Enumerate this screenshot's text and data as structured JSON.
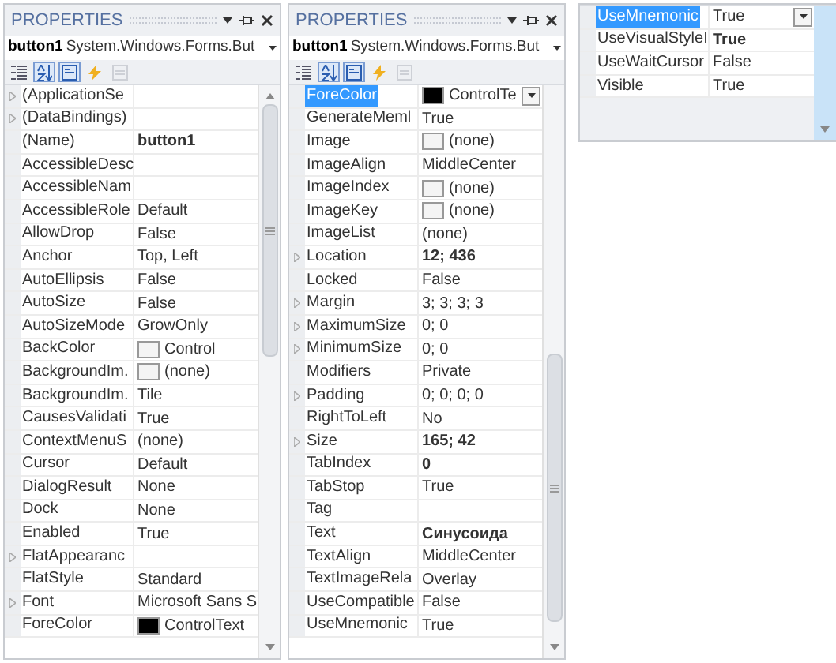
{
  "panels": [
    {
      "title": "PROPERTIES",
      "object_name": "button1",
      "object_type": "System.Windows.Forms.But",
      "toolbar": [
        {
          "kind": "categorized",
          "selected": false,
          "disabled": false
        },
        {
          "kind": "alphabetical",
          "selected": true,
          "disabled": false
        },
        {
          "kind": "properties",
          "selected": true,
          "disabled": false
        },
        {
          "kind": "events",
          "selected": false,
          "disabled": false
        },
        {
          "kind": "pages",
          "selected": false,
          "disabled": true
        }
      ],
      "rows": [
        {
          "name": "(ApplicationSe",
          "value": "",
          "expandable": true,
          "selected": false
        },
        {
          "name": "(DataBindings)",
          "value": "",
          "expandable": true,
          "selected": false
        },
        {
          "name": "(Name)",
          "value": "button1",
          "expandable": false,
          "bold": true,
          "selected": false
        },
        {
          "name": "AccessibleDesc",
          "value": "",
          "expandable": false,
          "selected": false
        },
        {
          "name": "AccessibleNam",
          "value": "",
          "expandable": false,
          "selected": false
        },
        {
          "name": "AccessibleRole",
          "value": "Default",
          "expandable": false,
          "bold": false,
          "selected": false
        },
        {
          "name": "AllowDrop",
          "value": "False",
          "expandable": false,
          "bold": false,
          "selected": false
        },
        {
          "name": "Anchor",
          "value": "Top, Left",
          "expandable": false,
          "bold": false,
          "selected": false
        },
        {
          "name": "AutoEllipsis",
          "value": "False",
          "expandable": false,
          "bold": false,
          "selected": false
        },
        {
          "name": "AutoSize",
          "value": "False",
          "expandable": false,
          "bold": false,
          "selected": false
        },
        {
          "name": "AutoSizeMode",
          "value": "GrowOnly",
          "expandable": false,
          "bold": false,
          "selected": false
        },
        {
          "name": "BackColor",
          "value": "Control",
          "expandable": false,
          "bold": false,
          "selected": false,
          "color": "#f4f4f4"
        },
        {
          "name": "BackgroundIm.",
          "value": "(none)",
          "expandable": false,
          "bold": false,
          "selected": false,
          "color": "#f4f4f4"
        },
        {
          "name": "BackgroundIm.",
          "value": "Tile",
          "expandable": false,
          "bold": false,
          "selected": false
        },
        {
          "name": "CausesValidati",
          "value": "True",
          "expandable": false,
          "bold": false,
          "selected": false
        },
        {
          "name": "ContextMenuS",
          "value": "(none)",
          "expandable": false,
          "bold": false,
          "selected": false
        },
        {
          "name": "Cursor",
          "value": "Default",
          "expandable": false,
          "bold": false,
          "selected": false
        },
        {
          "name": "DialogResult",
          "value": "None",
          "expandable": false,
          "bold": false,
          "selected": false
        },
        {
          "name": "Dock",
          "value": "None",
          "expandable": false,
          "bold": false,
          "selected": false
        },
        {
          "name": "Enabled",
          "value": "True",
          "expandable": false,
          "bold": false,
          "selected": false
        },
        {
          "name": "FlatAppearanc",
          "value": "",
          "expandable": true,
          "selected": false
        },
        {
          "name": "FlatStyle",
          "value": "Standard",
          "expandable": false,
          "bold": false,
          "selected": false
        },
        {
          "name": "Font",
          "value": "Microsoft Sans S",
          "expandable": true,
          "bold": false,
          "selected": false
        },
        {
          "name": "ForeColor",
          "value": "ControlText",
          "expandable": false,
          "bold": false,
          "selected": false,
          "color": "#000000"
        }
      ]
    },
    {
      "title": "PROPERTIES",
      "object_name": "button1",
      "object_type": "System.Windows.Forms.But",
      "toolbar": [
        {
          "kind": "categorized",
          "selected": false,
          "disabled": false
        },
        {
          "kind": "alphabetical",
          "selected": true,
          "disabled": false
        },
        {
          "kind": "properties",
          "selected": true,
          "disabled": false
        },
        {
          "kind": "events",
          "selected": false,
          "disabled": false
        },
        {
          "kind": "pages",
          "selected": false,
          "disabled": true
        }
      ],
      "rows": [
        {
          "name": "ForeColor",
          "value": "ControlTe",
          "expandable": false,
          "bold": false,
          "selected": true,
          "color": "#000000",
          "dropdown": true
        },
        {
          "name": "GenerateMeml",
          "value": "True",
          "expandable": false,
          "bold": false,
          "selected": false
        },
        {
          "name": "Image",
          "value": "(none)",
          "expandable": false,
          "bold": false,
          "selected": false,
          "color": "#f4f4f4"
        },
        {
          "name": "ImageAlign",
          "value": "MiddleCenter",
          "expandable": false,
          "bold": false,
          "selected": false
        },
        {
          "name": "ImageIndex",
          "value": "(none)",
          "expandable": false,
          "bold": false,
          "selected": false,
          "color": "#f4f4f4"
        },
        {
          "name": "ImageKey",
          "value": "(none)",
          "expandable": false,
          "bold": false,
          "selected": false,
          "color": "#f4f4f4"
        },
        {
          "name": "ImageList",
          "value": "(none)",
          "expandable": false,
          "bold": false,
          "selected": false
        },
        {
          "name": "Location",
          "value": "12; 436",
          "expandable": true,
          "bold": true,
          "selected": false
        },
        {
          "name": "Locked",
          "value": "False",
          "expandable": false,
          "bold": false,
          "selected": false
        },
        {
          "name": "Margin",
          "value": "3; 3; 3; 3",
          "expandable": true,
          "bold": false,
          "selected": false
        },
        {
          "name": "MaximumSize",
          "value": "0; 0",
          "expandable": true,
          "bold": false,
          "selected": false
        },
        {
          "name": "MinimumSize",
          "value": "0; 0",
          "expandable": true,
          "bold": false,
          "selected": false
        },
        {
          "name": "Modifiers",
          "value": "Private",
          "expandable": false,
          "bold": false,
          "selected": false
        },
        {
          "name": "Padding",
          "value": "0; 0; 0; 0",
          "expandable": true,
          "bold": false,
          "selected": false
        },
        {
          "name": "RightToLeft",
          "value": "No",
          "expandable": false,
          "bold": false,
          "selected": false
        },
        {
          "name": "Size",
          "value": "165; 42",
          "expandable": true,
          "bold": true,
          "selected": false
        },
        {
          "name": "TabIndex",
          "value": "0",
          "expandable": false,
          "bold": true,
          "selected": false
        },
        {
          "name": "TabStop",
          "value": "True",
          "expandable": false,
          "bold": false,
          "selected": false
        },
        {
          "name": "Tag",
          "value": "",
          "expandable": false,
          "selected": false
        },
        {
          "name": "Text",
          "value": "Синусоида",
          "expandable": false,
          "bold": true,
          "selected": false
        },
        {
          "name": "TextAlign",
          "value": "MiddleCenter",
          "expandable": false,
          "bold": false,
          "selected": false
        },
        {
          "name": "TextImageRela",
          "value": "Overlay",
          "expandable": false,
          "bold": false,
          "selected": false
        },
        {
          "name": "UseCompatible",
          "value": "False",
          "expandable": false,
          "bold": false,
          "selected": false
        },
        {
          "name": "UseMnemonic",
          "value": "True",
          "expandable": false,
          "bold": false,
          "selected": false
        }
      ]
    },
    {
      "rows": [
        {
          "name": "UseMnemonic",
          "value": "True",
          "expandable": false,
          "bold": false,
          "selected": true,
          "dropdown": true
        },
        {
          "name": "UseVisualStyleI",
          "value": "True",
          "expandable": false,
          "bold": true,
          "selected": false
        },
        {
          "name": "UseWaitCursor",
          "value": "False",
          "expandable": false,
          "bold": false,
          "selected": false
        },
        {
          "name": "Visible",
          "value": "True",
          "expandable": false,
          "bold": false,
          "selected": false
        }
      ]
    }
  ]
}
